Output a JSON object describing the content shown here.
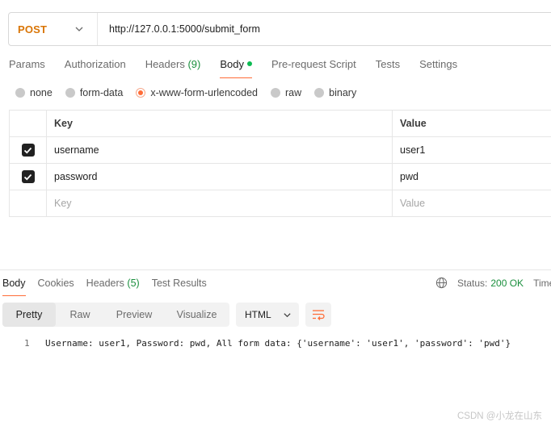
{
  "request": {
    "method": "POST",
    "url": "http://127.0.0.1:5000/submit_form"
  },
  "request_tabs": [
    {
      "label": "Params"
    },
    {
      "label": "Authorization"
    },
    {
      "label": "Headers",
      "count": "(9)"
    },
    {
      "label": "Body",
      "active": true
    },
    {
      "label": "Pre-request Script"
    },
    {
      "label": "Tests"
    },
    {
      "label": "Settings"
    }
  ],
  "body_types": [
    {
      "label": "none"
    },
    {
      "label": "form-data"
    },
    {
      "label": "x-www-form-urlencoded",
      "selected": true
    },
    {
      "label": "raw"
    },
    {
      "label": "binary"
    }
  ],
  "params_table": {
    "headers": {
      "key": "Key",
      "value": "Value"
    },
    "rows": [
      {
        "checked": true,
        "key": "username",
        "value": "user1"
      },
      {
        "checked": true,
        "key": "password",
        "value": "pwd"
      }
    ],
    "placeholder": {
      "key": "Key",
      "value": "Value"
    }
  },
  "response_tabs": [
    {
      "label": "Body",
      "active": true
    },
    {
      "label": "Cookies"
    },
    {
      "label": "Headers",
      "count": "(5)"
    },
    {
      "label": "Test Results"
    }
  ],
  "status": {
    "label": "Status:",
    "value": "200 OK",
    "time_label": "Time"
  },
  "view_modes": [
    {
      "label": "Pretty",
      "active": true
    },
    {
      "label": "Raw"
    },
    {
      "label": "Preview"
    },
    {
      "label": "Visualize"
    }
  ],
  "format": {
    "selected": "HTML"
  },
  "response_body": {
    "lines": [
      {
        "number": "1",
        "text": "Username: user1, Password: pwd, All form data: {'username': 'user1', 'password': 'pwd'}"
      }
    ]
  },
  "watermark": "CSDN @小龙在山东",
  "colors": {
    "accent": "#ff6c37",
    "method_post": "#d97506",
    "status_ok": "#1a8f3d",
    "body_dot": "#0cbb52"
  },
  "icons": [
    "chevron-down-icon",
    "globe-icon",
    "wrap-lines-icon",
    "check-icon"
  ]
}
